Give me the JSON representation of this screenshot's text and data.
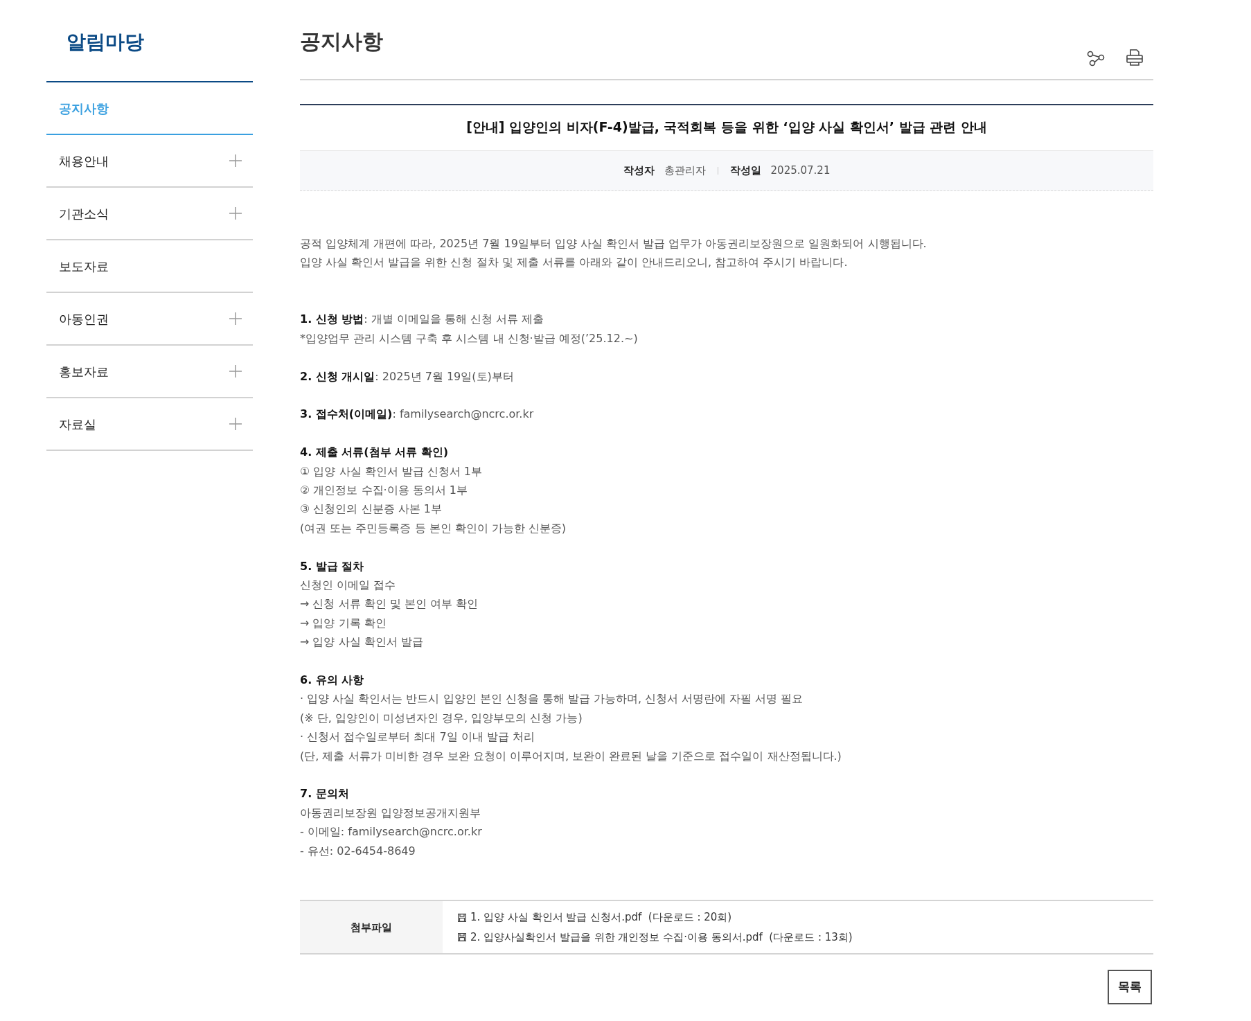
{
  "sidebar": {
    "title": "알림마당",
    "items": [
      {
        "label": "공지사항",
        "selected": true,
        "expandable": false
      },
      {
        "label": "채용안내",
        "selected": false,
        "expandable": true
      },
      {
        "label": "기관소식",
        "selected": false,
        "expandable": true
      },
      {
        "label": "보도자료",
        "selected": false,
        "expandable": false
      },
      {
        "label": "아동인권",
        "selected": false,
        "expandable": true
      },
      {
        "label": "홍보자료",
        "selected": false,
        "expandable": true
      },
      {
        "label": "자료실",
        "selected": false,
        "expandable": true
      }
    ]
  },
  "page_title": "공지사항",
  "post": {
    "title": "[안내] 입양인의 비자(F-4)발급, 국적회복 등을 위한 ‘입양 사실 확인서’ 발급 관련 안내",
    "meta": [
      {
        "label": "작성자",
        "value": "총관리자"
      },
      {
        "label": "작성일",
        "value": "2025.07.21"
      }
    ],
    "body": [
      [
        {
          "kind": "text",
          "text": "공적 입양체계 개편에 따라, 2025년 7월 19일부터 입양 사실 확인서 발급 업무가 아동권리보장원으로 일원화되어 시행됩니다."
        },
        {
          "kind": "text",
          "text": "입양 사실 확인서 발급을 위한 신청 절차 및 제출 서류를 아래와 같이 안내드리오니, 참고하여 주시기 바랍니다."
        }
      ],
      [
        {
          "kind": "text",
          "text": "**1. 신청 방법**: 개별 이메일을 통해 신청 서류 제출"
        },
        {
          "kind": "text",
          "text": "*입양업무 관리 시스템 구축 후 시스템 내 신청·발급 예정(’25.12.~)"
        }
      ],
      [
        {
          "kind": "text",
          "text": "**2. 신청 개시일**: 2025년 7월 19일(토)부터"
        }
      ],
      [
        {
          "kind": "text",
          "text": "**3. 접수처(이메일)**: familysearch@ncrc.or.kr"
        }
      ],
      [
        {
          "kind": "heading",
          "text": "4. 제출 서류(첨부 서류 확인)"
        },
        {
          "kind": "text",
          "text": "① 입양 사실 확인서 발급 신청서 1부"
        },
        {
          "kind": "text",
          "text": "② 개인정보 수집·이용 동의서 1부"
        },
        {
          "kind": "text",
          "text": "③ 신청인의 신분증 사본 1부"
        },
        {
          "kind": "text",
          "text": "(여권 또는 주민등록증 등 본인 확인이 가능한 신분증)"
        }
      ],
      [
        {
          "kind": "heading",
          "text": "5. 발급 절차"
        },
        {
          "kind": "text",
          "text": "신청인 이메일 접수"
        },
        {
          "kind": "text",
          "text": "→ 신청 서류 확인 및 본인 여부 확인"
        },
        {
          "kind": "text",
          "text": "→ 입양 기록 확인"
        },
        {
          "kind": "text",
          "text": "→ 입양 사실 확인서 발급"
        }
      ],
      [
        {
          "kind": "heading",
          "text": "6. 유의 사항"
        },
        {
          "kind": "text",
          "text": "· 입양 사실 확인서는 반드시 입양인 본인 신청을 통해 발급 가능하며, 신청서 서명란에 자필 서명 필요"
        },
        {
          "kind": "text",
          "text": "(※ 단, 입양인이 미성년자인 경우, 입양부모의 신청 가능)"
        },
        {
          "kind": "text",
          "text": "· 신청서 접수일로부터 최대 7일 이내 발급 처리"
        },
        {
          "kind": "text",
          "text": "(단, 제출 서류가 미비한 경우 보완 요청이 이루어지며, 보완이 완료된 날을 기준으로 접수일이 재산정됩니다.)"
        }
      ],
      [
        {
          "kind": "heading",
          "text": "7. 문의처"
        },
        {
          "kind": "text",
          "text": "아동권리보장원 입양정보공개지원부"
        },
        {
          "kind": "text",
          "text": "- 이메일: familysearch@ncrc.or.kr"
        },
        {
          "kind": "text",
          "text": "- 유선: 02-6454-8649"
        }
      ]
    ],
    "attachments": {
      "label": "첨부파일",
      "files": [
        {
          "name": "1. 입양 사실 확인서 발급 신청서.pdf",
          "downloads": "(다운로드 : 20회)"
        },
        {
          "name": "2. 입양사실확인서 발급을 위한 개인정보 수집·이용 동의서.pdf",
          "downloads": "(다운로드 : 13회)"
        }
      ]
    }
  },
  "list_button": "목록"
}
